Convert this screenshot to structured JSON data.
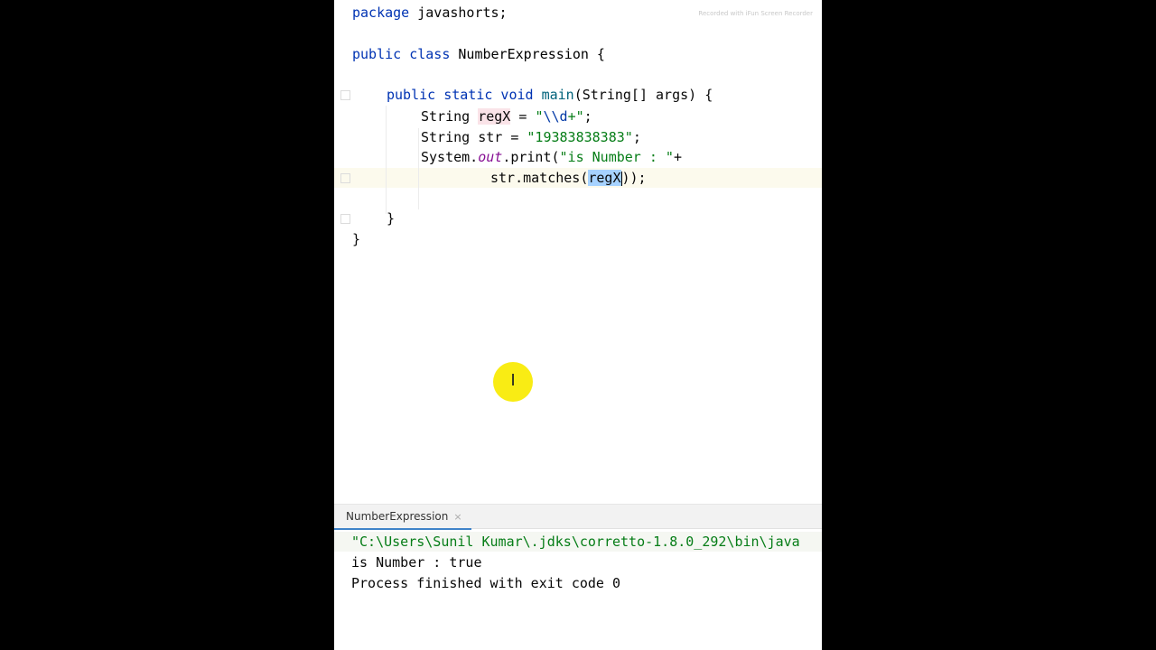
{
  "editor": {
    "watermark": "Recorded with iFun Screen Recorder",
    "line1": {
      "kw": "package",
      "rest": " javashorts;"
    },
    "line2": {
      "kw": "public class",
      "name": " NumberExpression {"
    },
    "line3": {
      "kw": "public static void",
      "name": " main",
      "rest": "(String[] args) {"
    },
    "line4": {
      "type": "String ",
      "var": "regX",
      "eq": " = ",
      "q1": "\"",
      "esc": "\\\\d",
      "str": "+\"",
      "end": ";"
    },
    "line5": {
      "type": "String str = ",
      "str": "\"19383838383\"",
      "end": ";"
    },
    "line6": {
      "sys": "System.",
      "field": "out",
      "call": ".print(",
      "str": "\"is Number : \"",
      "end": "+"
    },
    "line7": {
      "call": "str.matches(",
      "arg": "regX",
      "end": "));"
    },
    "line9": "}",
    "line10": "}"
  },
  "run_panel": {
    "tab_label": "NumberExpression",
    "close_icon": "×",
    "output": [
      "\"C:\\Users\\Sunil Kumar\\.jdks\\corretto-1.8.0_292\\bin\\java",
      "is Number : true",
      "Process finished with exit code 0"
    ]
  },
  "cursor": {
    "icon": "I"
  },
  "colors": {
    "keyword": "#0033b3",
    "string": "#067d17",
    "field": "#871094",
    "selection": "#a6d2ff",
    "cursor_highlight": "#f9ec14"
  }
}
